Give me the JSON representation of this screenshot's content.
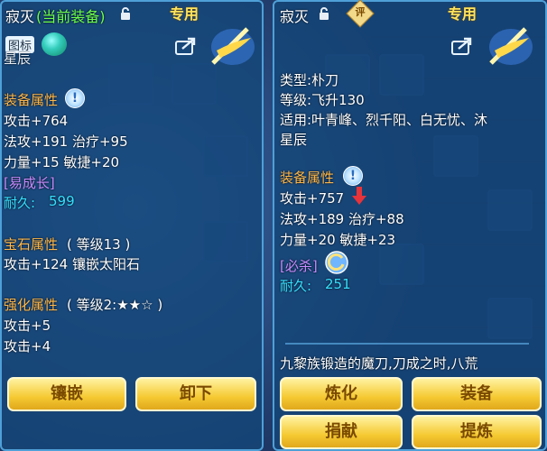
{
  "left": {
    "name": "寂灭",
    "equipped": "(当前装备)",
    "special": "专用",
    "icon_badge": "图标",
    "cut_top": "星辰",
    "attr_header": "装备属性",
    "attrs": [
      "攻击+764",
      "法攻+191 治疗+95",
      "力量+15 敏捷+20"
    ],
    "growth": "[易成长]",
    "durability_label": "耐久:",
    "durability_value": "599",
    "gem_header": "宝石属性",
    "gem_level": "( 等级13 )",
    "gem_line": "攻击+124 镶嵌太阳石",
    "enh_header": "强化属性",
    "enh_level": "( 等级2:★★☆ )",
    "enh_lines": [
      "攻击+5",
      "攻击+4"
    ],
    "btn_inlay": "镶嵌",
    "btn_remove": "卸下"
  },
  "right": {
    "name": "寂灭",
    "special": "专用",
    "badge": "评",
    "type_line": "类型:朴刀",
    "level_line": "等级:飞升130",
    "fit_line": "适用:叶青峰、烈千阳、白无忧、沐",
    "fit_line2": "星辰",
    "attr_header": "装备属性",
    "attrs": [
      "攻击+757",
      "法攻+189 治疗+88",
      "力量+20 敏捷+23"
    ],
    "kill": "[必杀]",
    "durability_label": "耐久:",
    "durability_value": "251",
    "desc": "九黎族锻造的魔刀,刀成之时,八荒",
    "btn_refine": "炼化",
    "btn_equip": "装备",
    "btn_donate": "捐献",
    "btn_extract": "提炼"
  },
  "colors": {
    "title_white": "#ffffff",
    "equipped_green": "#6cff4a",
    "header_orange": "#ffb84a",
    "value_cyan": "#34e0ff",
    "special_purple": "#c88bff",
    "button_gold": "#f5c932",
    "down_arrow_red": "#e8333a"
  },
  "icons": [
    "lock-icon",
    "share-icon",
    "sword-emblem-icon",
    "hint-icon",
    "down-arrow-icon",
    "kill-skill-icon",
    "rate-badge-icon"
  ]
}
